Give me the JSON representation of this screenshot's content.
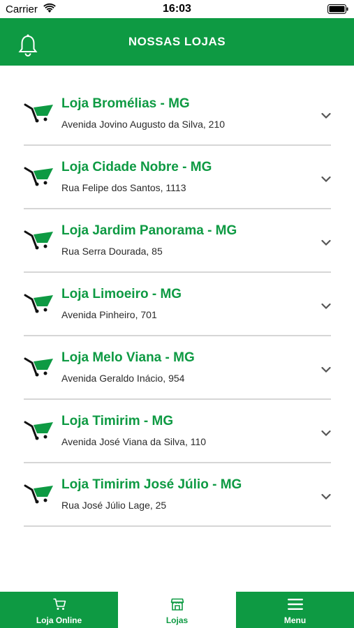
{
  "status_bar": {
    "carrier": "Carrier",
    "time": "16:03"
  },
  "header": {
    "title": "NOSSAS LOJAS",
    "bell_icon": "bell-icon"
  },
  "colors": {
    "brand_green": "#0e9a43",
    "divider": "#d6d6d6",
    "text_dark": "#2a2a2a"
  },
  "stores": [
    {
      "name": "Loja Bromélias - MG",
      "address": "Avenida Jovino Augusto da Silva, 210"
    },
    {
      "name": "Loja Cidade Nobre - MG",
      "address": "Rua Felipe dos Santos, 1113"
    },
    {
      "name": "Loja Jardim Panorama - MG",
      "address": "Rua Serra Dourada, 85"
    },
    {
      "name": "Loja Limoeiro - MG",
      "address": "Avenida Pinheiro, 701"
    },
    {
      "name": "Loja Melo Viana - MG",
      "address": "Avenida Geraldo Inácio, 954"
    },
    {
      "name": "Loja Timirim - MG",
      "address": "Avenida José Viana da Silva, 110"
    },
    {
      "name": "Loja Timirim José Júlio - MG",
      "address": "Rua José Júlio Lage, 25"
    }
  ],
  "tabs": [
    {
      "label": "Loja Online",
      "icon": "cart-icon",
      "active": false
    },
    {
      "label": "Lojas",
      "icon": "store-icon",
      "active": true
    },
    {
      "label": "Menu",
      "icon": "menu-icon",
      "active": false
    }
  ]
}
